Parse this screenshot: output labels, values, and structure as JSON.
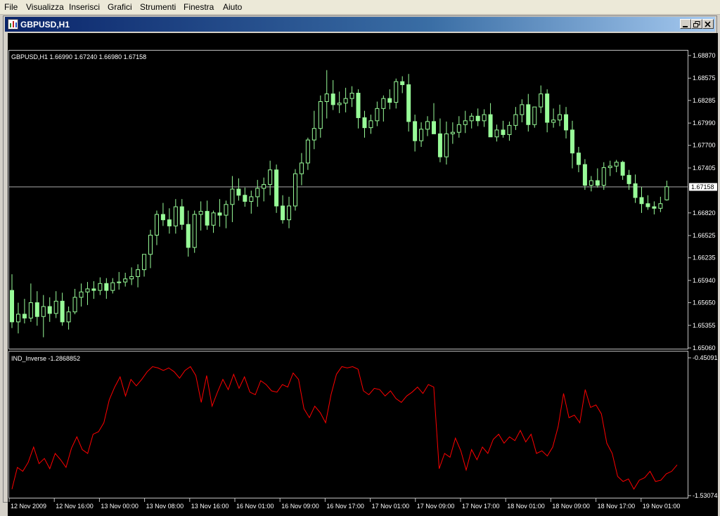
{
  "menu": {
    "file": "File",
    "visualizza": "Visualizza",
    "inserisci": "Inserisci",
    "grafici": "Grafici",
    "strumenti": "Strumenti",
    "finestra": "Finestra",
    "aiuto": "Aiuto"
  },
  "window": {
    "title": "GBPUSD,H1",
    "icon": "chart-window-icon"
  },
  "colors": {
    "background": "#000000",
    "candle": "#98fb98",
    "indicator_line": "#ff0000",
    "current_price_line": "#a9a9a9",
    "axis_text": "#ffffff"
  },
  "main_panel": {
    "info": "GBPUSD,H1  1.66990 1.67240 1.66980 1.67158",
    "current_price_label": "1.67158",
    "price_ticks": [
      "1.68870",
      "1.68575",
      "1.68285",
      "1.67990",
      "1.67700",
      "1.67405",
      "1.66820",
      "1.66525",
      "1.66235",
      "1.65940",
      "1.65650",
      "1.65355",
      "1.65060"
    ]
  },
  "indicator_panel": {
    "info": "IND_Inverse -1.2868852",
    "ticks": [
      "-0.45091",
      "-1.53074"
    ]
  },
  "time_axis": [
    "12 Nov 2009",
    "12 Nov 16:00",
    "13 Nov 00:00",
    "13 Nov 08:00",
    "13 Nov 16:00",
    "16 Nov 01:00",
    "16 Nov 09:00",
    "16 Nov 17:00",
    "17 Nov 01:00",
    "17 Nov 09:00",
    "17 Nov 17:00",
    "18 Nov 01:00",
    "18 Nov 09:00",
    "18 Nov 17:00",
    "19 Nov 01:00"
  ],
  "chart_data": [
    {
      "type": "candlestick",
      "symbol": "GBPUSD",
      "timeframe": "H1",
      "ylim": [
        1.6506,
        1.6887
      ],
      "current_price": 1.67158,
      "candles": [
        [
          1.6581,
          1.6602,
          1.6532,
          1.654
        ],
        [
          1.654,
          1.6565,
          1.6525,
          1.655
        ],
        [
          1.655,
          1.657,
          1.6538,
          1.6545
        ],
        [
          1.6545,
          1.659,
          1.654,
          1.6565
        ],
        [
          1.6565,
          1.658,
          1.6535,
          1.6547
        ],
        [
          1.6547,
          1.6575,
          1.652,
          1.656
        ],
        [
          1.656,
          1.6572,
          1.654,
          1.6551
        ],
        [
          1.6551,
          1.658,
          1.6545,
          1.6567
        ],
        [
          1.6567,
          1.6578,
          1.6535,
          1.654
        ],
        [
          1.654,
          1.656,
          1.653,
          1.6553
        ],
        [
          1.6553,
          1.6583,
          1.655,
          1.6572
        ],
        [
          1.6572,
          1.659,
          1.656,
          1.6579
        ],
        [
          1.6579,
          1.6592,
          1.6562,
          1.6583
        ],
        [
          1.6583,
          1.6593,
          1.657,
          1.6581
        ],
        [
          1.6581,
          1.6598,
          1.6575,
          1.659
        ],
        [
          1.659,
          1.6597,
          1.657,
          1.6581
        ],
        [
          1.6581,
          1.6597,
          1.6577,
          1.6591
        ],
        [
          1.6591,
          1.6605,
          1.6582,
          1.6592
        ],
        [
          1.6592,
          1.6604,
          1.6586,
          1.6596
        ],
        [
          1.6596,
          1.6611,
          1.6588,
          1.6599
        ],
        [
          1.6599,
          1.6615,
          1.6585,
          1.6608
        ],
        [
          1.6608,
          1.6627,
          1.6599,
          1.6628
        ],
        [
          1.6628,
          1.666,
          1.661,
          1.6653
        ],
        [
          1.6653,
          1.6685,
          1.664,
          1.668
        ],
        [
          1.668,
          1.6695,
          1.6665,
          1.6673
        ],
        [
          1.6673,
          1.6688,
          1.6655,
          1.6665
        ],
        [
          1.6665,
          1.67,
          1.6655,
          1.669
        ],
        [
          1.669,
          1.67,
          1.666,
          1.6667
        ],
        [
          1.6667,
          1.6685,
          1.6625,
          1.6637
        ],
        [
          1.6637,
          1.6685,
          1.663,
          1.668
        ],
        [
          1.668,
          1.6697,
          1.6659,
          1.6684
        ],
        [
          1.6684,
          1.6698,
          1.666,
          1.6666
        ],
        [
          1.6666,
          1.6685,
          1.6656,
          1.6682
        ],
        [
          1.6682,
          1.67,
          1.6664,
          1.6679
        ],
        [
          1.6679,
          1.6698,
          1.6662,
          1.6693
        ],
        [
          1.6693,
          1.673,
          1.667,
          1.6713
        ],
        [
          1.6713,
          1.6727,
          1.6698,
          1.6705
        ],
        [
          1.6705,
          1.6715,
          1.669,
          1.6697
        ],
        [
          1.6697,
          1.6711,
          1.6681,
          1.6703
        ],
        [
          1.6703,
          1.6725,
          1.669,
          1.6714
        ],
        [
          1.6714,
          1.6728,
          1.6697,
          1.6719
        ],
        [
          1.6719,
          1.675,
          1.6705,
          1.6738
        ],
        [
          1.6738,
          1.6745,
          1.6682,
          1.6691
        ],
        [
          1.6691,
          1.6705,
          1.6668,
          1.6673
        ],
        [
          1.6673,
          1.6703,
          1.6662,
          1.6691
        ],
        [
          1.6691,
          1.6739,
          1.6685,
          1.6733
        ],
        [
          1.6733,
          1.676,
          1.6718,
          1.6747
        ],
        [
          1.6747,
          1.678,
          1.6738,
          1.6777
        ],
        [
          1.6777,
          1.6815,
          1.6765,
          1.6792
        ],
        [
          1.6792,
          1.6835,
          1.678,
          1.6827
        ],
        [
          1.6827,
          1.6868,
          1.6805,
          1.6837
        ],
        [
          1.6837,
          1.6855,
          1.6816,
          1.6823
        ],
        [
          1.6823,
          1.684,
          1.6812,
          1.6825
        ],
        [
          1.6825,
          1.6845,
          1.6813,
          1.6831
        ],
        [
          1.6831,
          1.6847,
          1.682,
          1.6838
        ],
        [
          1.6838,
          1.6843,
          1.6792,
          1.6806
        ],
        [
          1.6806,
          1.6815,
          1.678,
          1.6793
        ],
        [
          1.6793,
          1.681,
          1.6785,
          1.6802
        ],
        [
          1.6802,
          1.6827,
          1.6795,
          1.6818
        ],
        [
          1.6818,
          1.6835,
          1.6801,
          1.6831
        ],
        [
          1.6831,
          1.6843,
          1.6817,
          1.6826
        ],
        [
          1.6826,
          1.6857,
          1.6818,
          1.6853
        ],
        [
          1.6853,
          1.686,
          1.6838,
          1.6849
        ],
        [
          1.6849,
          1.6863,
          1.6788,
          1.6801
        ],
        [
          1.6801,
          1.681,
          1.6762,
          1.6776
        ],
        [
          1.6776,
          1.68,
          1.6768,
          1.6791
        ],
        [
          1.6791,
          1.6808,
          1.6782,
          1.6801
        ],
        [
          1.6801,
          1.6825,
          1.679,
          1.6785
        ],
        [
          1.6785,
          1.6805,
          1.6748,
          1.6755
        ],
        [
          1.6755,
          1.6801,
          1.6745,
          1.6785
        ],
        [
          1.6785,
          1.68,
          1.6772,
          1.6787
        ],
        [
          1.6787,
          1.6808,
          1.678,
          1.6797
        ],
        [
          1.6797,
          1.6815,
          1.6786,
          1.6802
        ],
        [
          1.6802,
          1.6812,
          1.6792,
          1.6808
        ],
        [
          1.6808,
          1.6818,
          1.6795,
          1.6802
        ],
        [
          1.6802,
          1.6817,
          1.6794,
          1.681
        ],
        [
          1.681,
          1.6825,
          1.679,
          1.6781
        ],
        [
          1.6781,
          1.6797,
          1.6775,
          1.679
        ],
        [
          1.679,
          1.6802,
          1.678,
          1.6784
        ],
        [
          1.6784,
          1.6801,
          1.6776,
          1.6796
        ],
        [
          1.6796,
          1.682,
          1.679,
          1.681
        ],
        [
          1.681,
          1.683,
          1.68,
          1.6823
        ],
        [
          1.6823,
          1.6837,
          1.6788,
          1.6797
        ],
        [
          1.6797,
          1.682,
          1.6793,
          1.682
        ],
        [
          1.682,
          1.6848,
          1.6812,
          1.6837
        ],
        [
          1.6837,
          1.6843,
          1.6787,
          1.68
        ],
        [
          1.68,
          1.6818,
          1.6793,
          1.6803
        ],
        [
          1.6803,
          1.6823,
          1.6795,
          1.681
        ],
        [
          1.681,
          1.682,
          1.6779,
          1.679
        ],
        [
          1.679,
          1.6802,
          1.674,
          1.676
        ],
        [
          1.676,
          1.6768,
          1.6735,
          1.6745
        ],
        [
          1.6745,
          1.6752,
          1.6712,
          1.6718
        ],
        [
          1.6718,
          1.673,
          1.671,
          1.6724
        ],
        [
          1.6724,
          1.674,
          1.6715,
          1.6718
        ],
        [
          1.6718,
          1.6748,
          1.6712,
          1.6741
        ],
        [
          1.6741,
          1.675,
          1.673,
          1.6743
        ],
        [
          1.6743,
          1.6751,
          1.6735,
          1.6748
        ],
        [
          1.6748,
          1.675,
          1.6725,
          1.6731
        ],
        [
          1.6731,
          1.6738,
          1.6712,
          1.672
        ],
        [
          1.672,
          1.6732,
          1.6695,
          1.6702
        ],
        [
          1.6702,
          1.6716,
          1.6682,
          1.6694
        ],
        [
          1.6694,
          1.6705,
          1.6686,
          1.669
        ],
        [
          1.669,
          1.6697,
          1.668,
          1.6688
        ],
        [
          1.6688,
          1.6703,
          1.6683,
          1.6694
        ],
        [
          1.6699,
          1.6724,
          1.6698,
          1.6716
        ]
      ]
    },
    {
      "type": "line",
      "name": "IND_Inverse",
      "current_value": -1.2868852,
      "ylim": [
        -1.53074,
        -0.45091
      ],
      "values": [
        -1.48,
        -1.31,
        -1.34,
        -1.27,
        -1.15,
        -1.28,
        -1.24,
        -1.32,
        -1.2,
        -1.25,
        -1.31,
        -1.16,
        -1.07,
        -1.17,
        -1.2,
        -1.05,
        -1.03,
        -0.96,
        -0.78,
        -0.68,
        -0.6,
        -0.75,
        -0.62,
        -0.67,
        -0.62,
        -0.56,
        -0.52,
        -0.53,
        -0.55,
        -0.53,
        -0.56,
        -0.61,
        -0.55,
        -0.52,
        -0.59,
        -0.8,
        -0.59,
        -0.83,
        -0.72,
        -0.62,
        -0.7,
        -0.58,
        -0.69,
        -0.6,
        -0.72,
        -0.74,
        -0.63,
        -0.66,
        -0.71,
        -0.72,
        -0.66,
        -0.68,
        -0.57,
        -0.62,
        -0.85,
        -0.92,
        -0.83,
        -0.88,
        -0.96,
        -0.74,
        -0.58,
        -0.52,
        -0.53,
        -0.52,
        -0.54,
        -0.71,
        -0.74,
        -0.69,
        -0.7,
        -0.75,
        -0.71,
        -0.77,
        -0.8,
        -0.75,
        -0.72,
        -0.68,
        -0.73,
        -0.66,
        -0.68,
        -1.32,
        -1.2,
        -1.23,
        -1.08,
        -1.18,
        -1.33,
        -1.17,
        -1.25,
        -1.15,
        -1.2,
        -1.09,
        -1.05,
        -1.12,
        -1.07,
        -1.1,
        -1.02,
        -1.11,
        -1.05,
        -1.2,
        -1.18,
        -1.22,
        -1.15,
        -0.99,
        -0.73,
        -0.92,
        -0.9,
        -0.96,
        -0.7,
        -0.84,
        -0.82,
        -0.89,
        -1.12,
        -1.2,
        -1.38,
        -1.42,
        -1.4,
        -1.48,
        -1.41,
        -1.39,
        -1.34,
        -1.42,
        -1.41,
        -1.36,
        -1.34,
        -1.29
      ]
    }
  ]
}
